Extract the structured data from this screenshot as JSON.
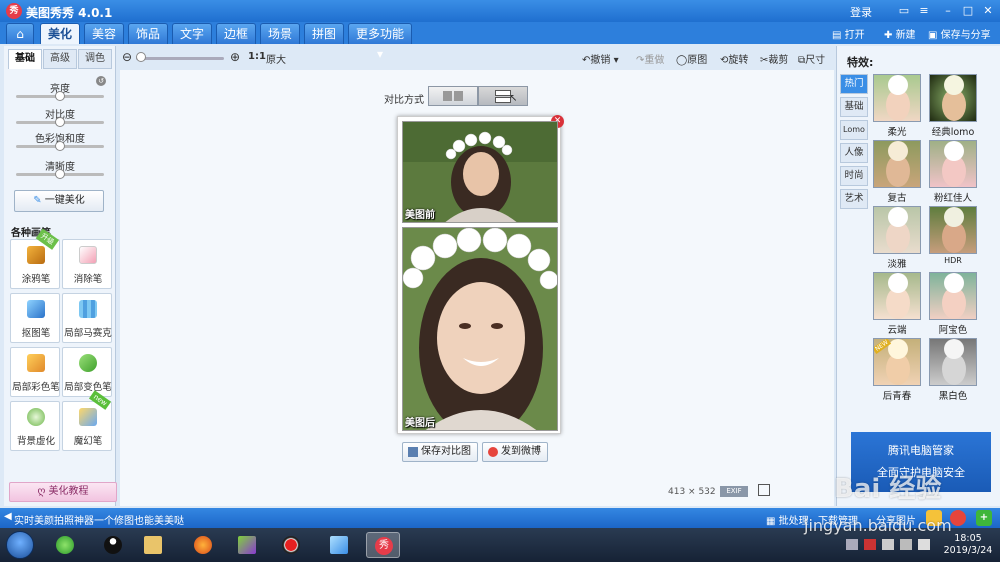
{
  "app": {
    "title": "美图秀秀 4.0.1",
    "logo_glyph": "秀",
    "login": "登录"
  },
  "nav": {
    "tabs": [
      "美化",
      "美容",
      "饰品",
      "文字",
      "边框",
      "场景",
      "拼图",
      "更多功能 ▾"
    ],
    "active_tab": "美化",
    "open": "打开",
    "new": "新建",
    "save_share": "保存与分享"
  },
  "toolbar": {
    "ratio": "1:1",
    "original_size": "原大",
    "undo": "撤销",
    "redo": "重做",
    "original": "原图",
    "rotate": "旋转",
    "crop": "裁剪",
    "resize": "尺寸",
    "zoom_level": 0
  },
  "left": {
    "subtabs": [
      "基础",
      "高级",
      "调色"
    ],
    "adjustments": [
      {
        "label": "亮度",
        "value": 0.5
      },
      {
        "label": "对比度",
        "value": 0.5
      },
      {
        "label": "色彩饱和度",
        "value": 0.5
      },
      {
        "label": "清晰度",
        "value": 0.5
      }
    ],
    "one_click": "一键美化",
    "brushes_title": "各种画笔",
    "tools": [
      {
        "label": "涂鸦笔",
        "ribbon": "升级"
      },
      {
        "label": "消除笔",
        "ribbon": ""
      },
      {
        "label": "抠图笔",
        "ribbon": ""
      },
      {
        "label": "局部马赛克",
        "ribbon": ""
      },
      {
        "label": "局部彩色笔",
        "ribbon": ""
      },
      {
        "label": "局部变色笔",
        "ribbon": ""
      },
      {
        "label": "背景虚化",
        "ribbon": ""
      },
      {
        "label": "魔幻笔",
        "ribbon": "new"
      }
    ],
    "tutorial": "美化教程"
  },
  "canvas": {
    "compare_label": "对比方式",
    "before_caption": "美图前",
    "after_caption": "美图后",
    "save_compare": "保存对比图",
    "send_weibo": "发到微博",
    "dimensions": "413 × 532"
  },
  "right": {
    "title": "特效:",
    "categories": [
      "热门",
      "基础",
      "Lomo",
      "人像",
      "时尚",
      "艺术"
    ],
    "effects": [
      {
        "label": "柔光",
        "badge": ""
      },
      {
        "label": "经典lomo",
        "badge": ""
      },
      {
        "label": "复古",
        "badge": ""
      },
      {
        "label": "粉红佳人",
        "badge": ""
      },
      {
        "label": "淡雅",
        "badge": ""
      },
      {
        "label": "HDR",
        "badge": ""
      },
      {
        "label": "云端",
        "badge": ""
      },
      {
        "label": "阿宝色",
        "badge": ""
      },
      {
        "label": "后青春",
        "badge": "NEW"
      },
      {
        "label": "黑白色",
        "badge": ""
      }
    ],
    "ad_line1": "腾讯电脑管家",
    "ad_line2": "全面守护电脑安全"
  },
  "status": {
    "message": "实时美颜拍照神器一个修图也能美美哒",
    "batch": "批处理",
    "download": "下载管理",
    "share": "分享图片"
  },
  "taskbar": {
    "time": "18:05",
    "date": "2019/3/24"
  },
  "watermark": {
    "line1": "Bai 经验",
    "line2": "jingyan.baidu.com"
  },
  "colors": {
    "brand_blue": "#2d7fdc",
    "accent_red": "#d9323a"
  }
}
